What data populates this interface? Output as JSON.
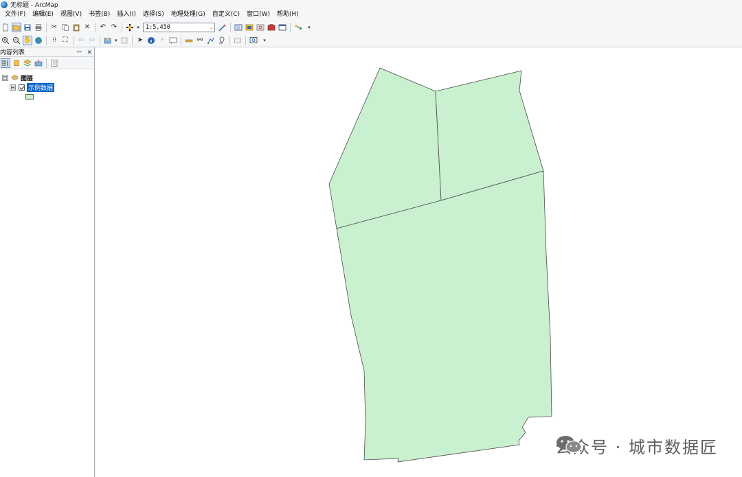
{
  "window": {
    "title": "无标题 - ArcMap"
  },
  "menu": [
    "文件(F)",
    "编辑(E)",
    "视图(V)",
    "书签(B)",
    "插入(I)",
    "选择(S)",
    "地理处理(G)",
    "自定义(C)",
    "窗口(W)",
    "帮助(H)"
  ],
  "toolbar": {
    "scale_value": "1:5,450"
  },
  "toc": {
    "title": "内容列表",
    "pin_glyph": "ᅲ",
    "close_glyph": "✕",
    "root": {
      "expander": "⊟",
      "label": "图层"
    },
    "layer": {
      "expander": "⊟",
      "label": "示例数据",
      "checked": true,
      "selected": true
    },
    "symbol_color": "#c9f0cf"
  },
  "map": {
    "polygon_fill": "#c9f0cf",
    "polygon_stroke": "#4a4a4a"
  },
  "watermark": {
    "text": "公众号 · 城市数据匠"
  },
  "colors": {
    "selection": "#0a64c8",
    "chrome": "#f5f6f7"
  }
}
